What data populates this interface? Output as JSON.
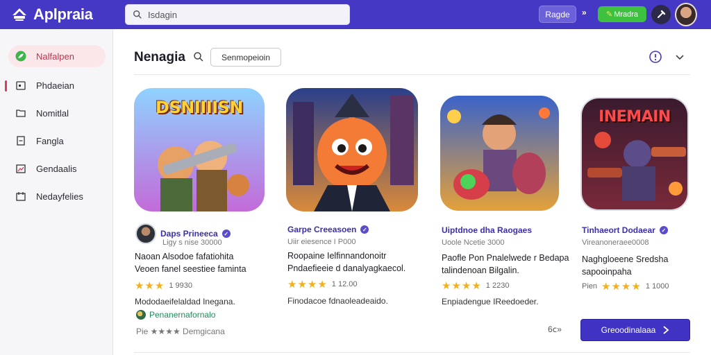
{
  "app": {
    "name": "Aplpraia"
  },
  "search": {
    "value": "Isdagin"
  },
  "topbar": {
    "page_button": "Ragde",
    "arrows": "»",
    "green_button": "Mradra",
    "green_icon": "pencil-icon"
  },
  "sidebar": {
    "items": [
      {
        "label": "Nalfalpen",
        "icon": "leaf-icon",
        "active": true
      },
      {
        "label": "Phdaeian",
        "icon": "calendar-icon"
      },
      {
        "label": "Nomitlal",
        "icon": "folder-icon"
      },
      {
        "label": "Fangla",
        "icon": "document-icon"
      },
      {
        "label": "Gendaalis",
        "icon": "image-icon"
      },
      {
        "label": "Nedayfelies",
        "icon": "inbox-icon"
      }
    ]
  },
  "main": {
    "title": "Nenagia",
    "button": "Senmopeioin"
  },
  "cards": [
    {
      "image_title": "DSNIIIISN",
      "developer": "Daps Prineeca",
      "sub": "Ligy s nise 30000",
      "desc": [
        "Naoan Alsodoe fafatiohita",
        "Veoen fanel seestiee faminta"
      ],
      "stars": 3,
      "rating": "1 9930",
      "foot": "Mododaeifelaldad Inegana.",
      "tag": "Penanernafornalo",
      "extra_stars": "Pie ★★★★ Demgicana"
    },
    {
      "image_title": "",
      "developer": "Garpe Creeasoen",
      "sub": "Uiir eiesence I P000",
      "desc": [
        "Roopaine Ielfinnandonoitr",
        "Pndaefieeie d danalyagkaecol."
      ],
      "stars": 4,
      "rating": "1 12.00",
      "foot": "Finodacoe fdnaoleadeaido."
    },
    {
      "image_title": "",
      "developer": "Uiptdnoe dha Raogaes",
      "sub": "Uoole Ncetie 3000",
      "desc": [
        "Paofle Pon Pnalelwede r Bedapa",
        "talindenoan Bilgalin."
      ],
      "stars": 4,
      "rating": "1 2230",
      "foot": "Enpiadengue IReedoeder."
    },
    {
      "image_title": "INEMAIN",
      "developer": "Tinhaeort Dodaear",
      "sub": "Vireanoneraee0008",
      "desc": [
        "Naghgloeene Sredsha",
        "sapooinpaha"
      ],
      "stars": 4,
      "rating": "1 1000",
      "prefix": "Pien"
    }
  ],
  "footer": {
    "more": "6ⅽ»",
    "cta": "Greoodinalaaa"
  }
}
